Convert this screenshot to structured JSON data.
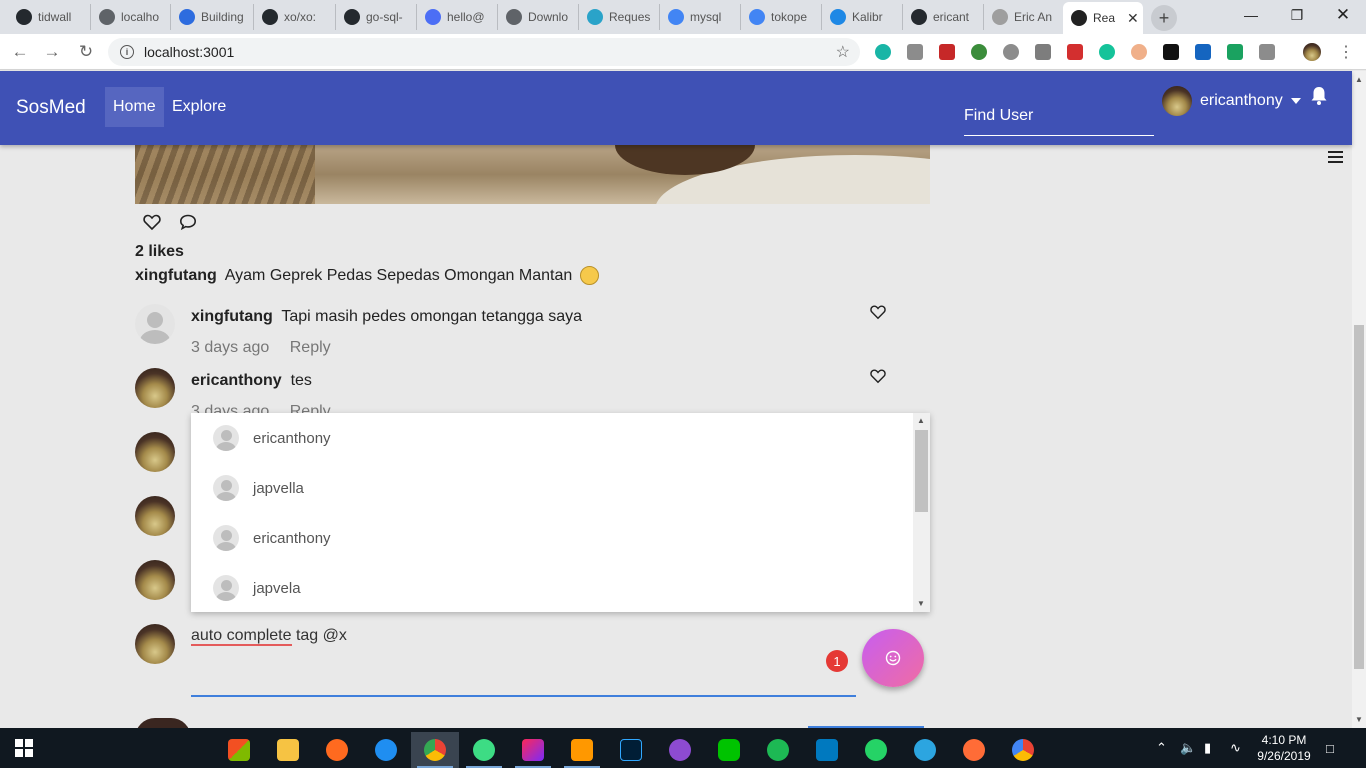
{
  "browser": {
    "tabs": [
      {
        "title": "tidwall",
        "icon": "github-icon",
        "color": "#24292e"
      },
      {
        "title": "localho",
        "icon": "globe-icon",
        "color": "#5f6368"
      },
      {
        "title": "Building",
        "icon": "r-icon",
        "color": "#2d6cdf"
      },
      {
        "title": "xo/xo:",
        "icon": "github-icon",
        "color": "#24292e"
      },
      {
        "title": "go-sql-",
        "icon": "github-icon",
        "color": "#24292e"
      },
      {
        "title": "hello@",
        "icon": "c-icon",
        "color": "#4c6ef5"
      },
      {
        "title": "Downlo",
        "icon": "download-icon",
        "color": "#5f6368"
      },
      {
        "title": "Reques",
        "icon": "book-icon",
        "color": "#2aa3c9"
      },
      {
        "title": "mysql",
        "icon": "google-icon",
        "color": "#4285f4"
      },
      {
        "title": "tokope",
        "icon": "google-icon",
        "color": "#4285f4"
      },
      {
        "title": "Kalibr",
        "icon": "k-icon",
        "color": "#1e88e5"
      },
      {
        "title": "ericant",
        "icon": "github-icon",
        "color": "#24292e"
      },
      {
        "title": "Eric An",
        "icon": "loading-icon",
        "color": "#9e9e9e"
      },
      {
        "title": "Rea",
        "icon": "react-icon",
        "color": "#222222"
      }
    ],
    "url": "localhost:3001"
  },
  "app": {
    "brand": "SosMed",
    "nav": [
      "Home",
      "Explore"
    ],
    "active_nav": "Home",
    "search_placeholder": "Find User",
    "username": "ericanthony",
    "accent": "#3f51b5"
  },
  "post": {
    "likes": "2 likes",
    "author": "xingfutang",
    "caption": "Ayam Geprek Pedas Sepedas Omongan Mantan"
  },
  "comments": [
    {
      "user": "xingfutang",
      "text": "Tapi masih pedes omongan tetangga saya",
      "time": "3 days ago",
      "reply": "Reply",
      "avatar": "default"
    },
    {
      "user": "ericanthony",
      "text": "tes",
      "time": "3 days ago",
      "reply": "Reply",
      "avatar": "photo"
    }
  ],
  "autocomplete": {
    "suggestions": [
      "ericanthony",
      "japvella",
      "ericanthony",
      "japvela"
    ]
  },
  "composer": {
    "value_underlined": "auto complete",
    "value_rest": " tag @x",
    "badge": "1"
  },
  "taskbar": {
    "time": "4:10 PM",
    "date": "9/26/2019"
  }
}
